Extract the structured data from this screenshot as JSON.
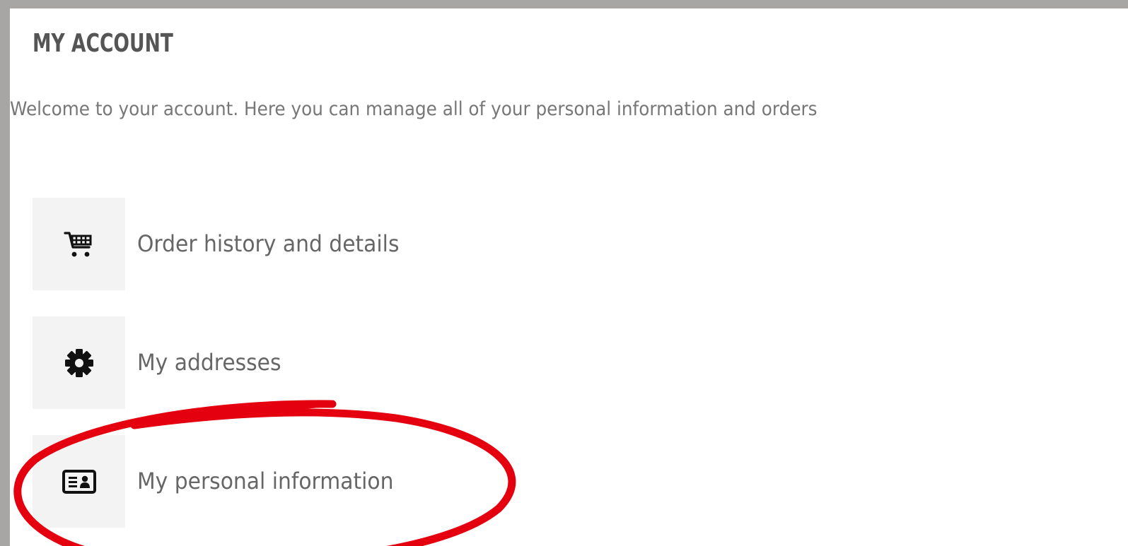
{
  "page": {
    "title": "MY ACCOUNT",
    "welcome": "Welcome to your account. Here you can manage all of your personal information and orders"
  },
  "menu": {
    "items": [
      {
        "label": "Order history and details",
        "icon": "cart-icon"
      },
      {
        "label": "My addresses",
        "icon": "gear-icon"
      },
      {
        "label": "My personal information",
        "icon": "id-card-icon"
      }
    ]
  },
  "colors": {
    "outer_background": "#a8a6a5",
    "panel_background": "#ffffff",
    "icon_tile": "#f3f3f3",
    "title_text": "#555555",
    "body_text": "#777777",
    "highlight": "#e4000f"
  }
}
